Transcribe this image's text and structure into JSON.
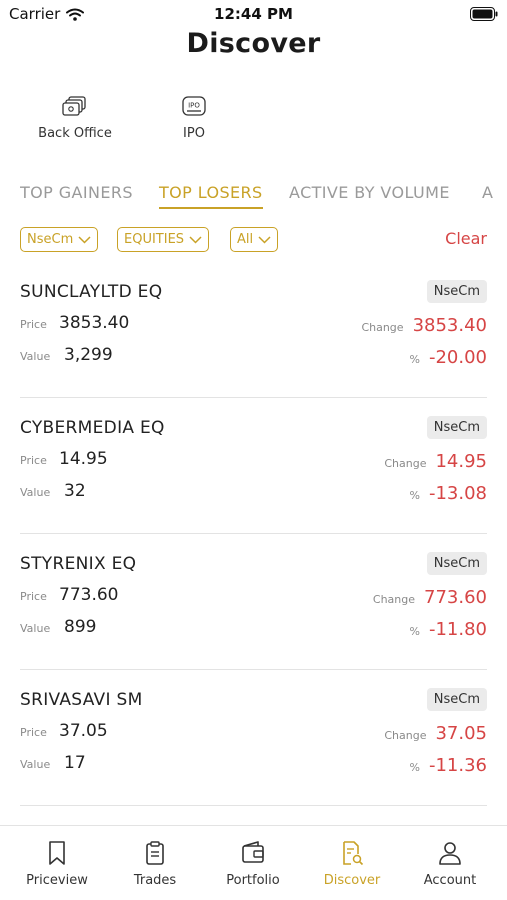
{
  "status_bar": {
    "carrier": "Carrier",
    "time": "12:44 PM"
  },
  "header": {
    "title": "Discover"
  },
  "shortcuts": [
    {
      "label": "Back Office",
      "icon": "back-office-icon"
    },
    {
      "label": "IPO",
      "icon": "ipo-icon"
    }
  ],
  "tabs": [
    {
      "label": "TOP GAINERS",
      "active": false
    },
    {
      "label": "TOP LOSERS",
      "active": true
    },
    {
      "label": "ACTIVE BY VOLUME",
      "active": false
    },
    {
      "label": "A",
      "active": false
    }
  ],
  "filters": {
    "exchange": "NseCm",
    "segment": "EQUITIES",
    "series": "All",
    "clear_label": "Clear"
  },
  "labels": {
    "price": "Price",
    "value": "Value",
    "change": "Change",
    "percent": "%"
  },
  "stocks": [
    {
      "name": "SUNCLAYLTD EQ",
      "exchange": "NseCm",
      "price": "3853.40",
      "value": "3,299",
      "change": "3853.40",
      "percent": "-20.00"
    },
    {
      "name": "CYBERMEDIA EQ",
      "exchange": "NseCm",
      "price": "14.95",
      "value": "32",
      "change": "14.95",
      "percent": "-13.08"
    },
    {
      "name": "STYRENIX EQ",
      "exchange": "NseCm",
      "price": "773.60",
      "value": "899",
      "change": "773.60",
      "percent": "-11.80"
    },
    {
      "name": "SRIVASAVI SM",
      "exchange": "NseCm",
      "price": "37.05",
      "value": "17",
      "change": "37.05",
      "percent": "-11.36"
    }
  ],
  "tab_bar": [
    {
      "label": "Priceview",
      "icon": "bookmark-icon",
      "active": false
    },
    {
      "label": "Trades",
      "icon": "clipboard-icon",
      "active": false
    },
    {
      "label": "Portfolio",
      "icon": "wallet-icon",
      "active": false
    },
    {
      "label": "Discover",
      "icon": "discover-icon",
      "active": true
    },
    {
      "label": "Account",
      "icon": "person-icon",
      "active": false
    }
  ],
  "colors": {
    "accent": "#c9a227",
    "negative": "#d64545",
    "muted": "#9a9a9a"
  }
}
